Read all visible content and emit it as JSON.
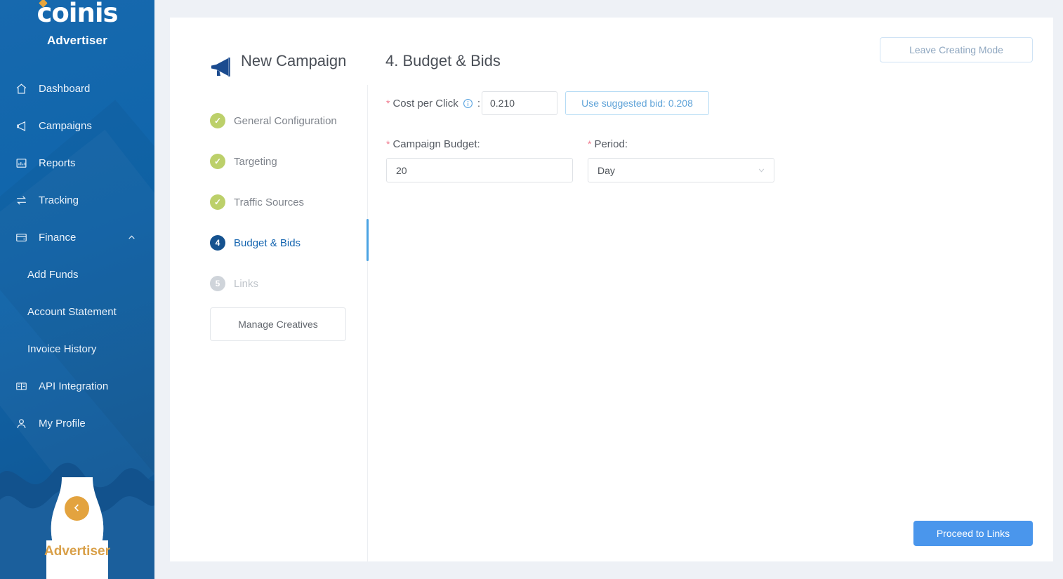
{
  "sidebar": {
    "logo": "coinis",
    "logo_icon": "sparkle-icon",
    "brand_sub": "Advertiser",
    "footer_label": "Advertiser",
    "collapse_icon": "chevron-left-icon",
    "accent_color": "#e3a33f",
    "bg_color": "#1265ab",
    "items": [
      {
        "label": "Dashboard",
        "icon": "home-icon"
      },
      {
        "label": "Campaigns",
        "icon": "megaphone-icon"
      },
      {
        "label": "Reports",
        "icon": "bar-chart-icon"
      },
      {
        "label": "Tracking",
        "icon": "swap-arrows-icon"
      },
      {
        "label": "Finance",
        "icon": "credit-card-icon",
        "chevron": "chevron-up-icon"
      }
    ],
    "finance_children": [
      {
        "label": "Add Funds"
      },
      {
        "label": "Account Statement"
      },
      {
        "label": "Invoice History"
      }
    ],
    "items_after": [
      {
        "label": "API Integration",
        "icon": "book-icon"
      },
      {
        "label": "My Profile",
        "icon": "user-icon"
      }
    ]
  },
  "header": {
    "campaign_icon": "megaphone-icon",
    "campaign_title": "New Campaign",
    "step_title": "4. Budget & Bids",
    "leave_button": "Leave Creating Mode"
  },
  "steps": [
    {
      "label": "General Configuration",
      "state": "done",
      "marker": "✓"
    },
    {
      "label": "Targeting",
      "state": "done",
      "marker": "✓"
    },
    {
      "label": "Traffic Sources",
      "state": "done",
      "marker": "✓"
    },
    {
      "label": "Budget & Bids",
      "state": "active",
      "marker": "4"
    },
    {
      "label": "Links",
      "state": "todo",
      "marker": "5"
    }
  ],
  "manage_creatives_button": "Manage Creatives",
  "form": {
    "cost_per_click": {
      "label": "Cost per Click",
      "required_mark": "*",
      "colon": ":",
      "info_icon": "info-circle-icon",
      "value": "0.210",
      "suggested_button": "Use suggested bid: 0.208"
    },
    "campaign_budget": {
      "label": "Campaign Budget",
      "required_mark": "*",
      "colon": ":",
      "value": "20"
    },
    "period": {
      "label": "Period",
      "required_mark": "*",
      "colon": ":",
      "value": "Day",
      "chevron": "chevron-down-icon"
    }
  },
  "footer": {
    "proceed_button": "Proceed to Links"
  }
}
